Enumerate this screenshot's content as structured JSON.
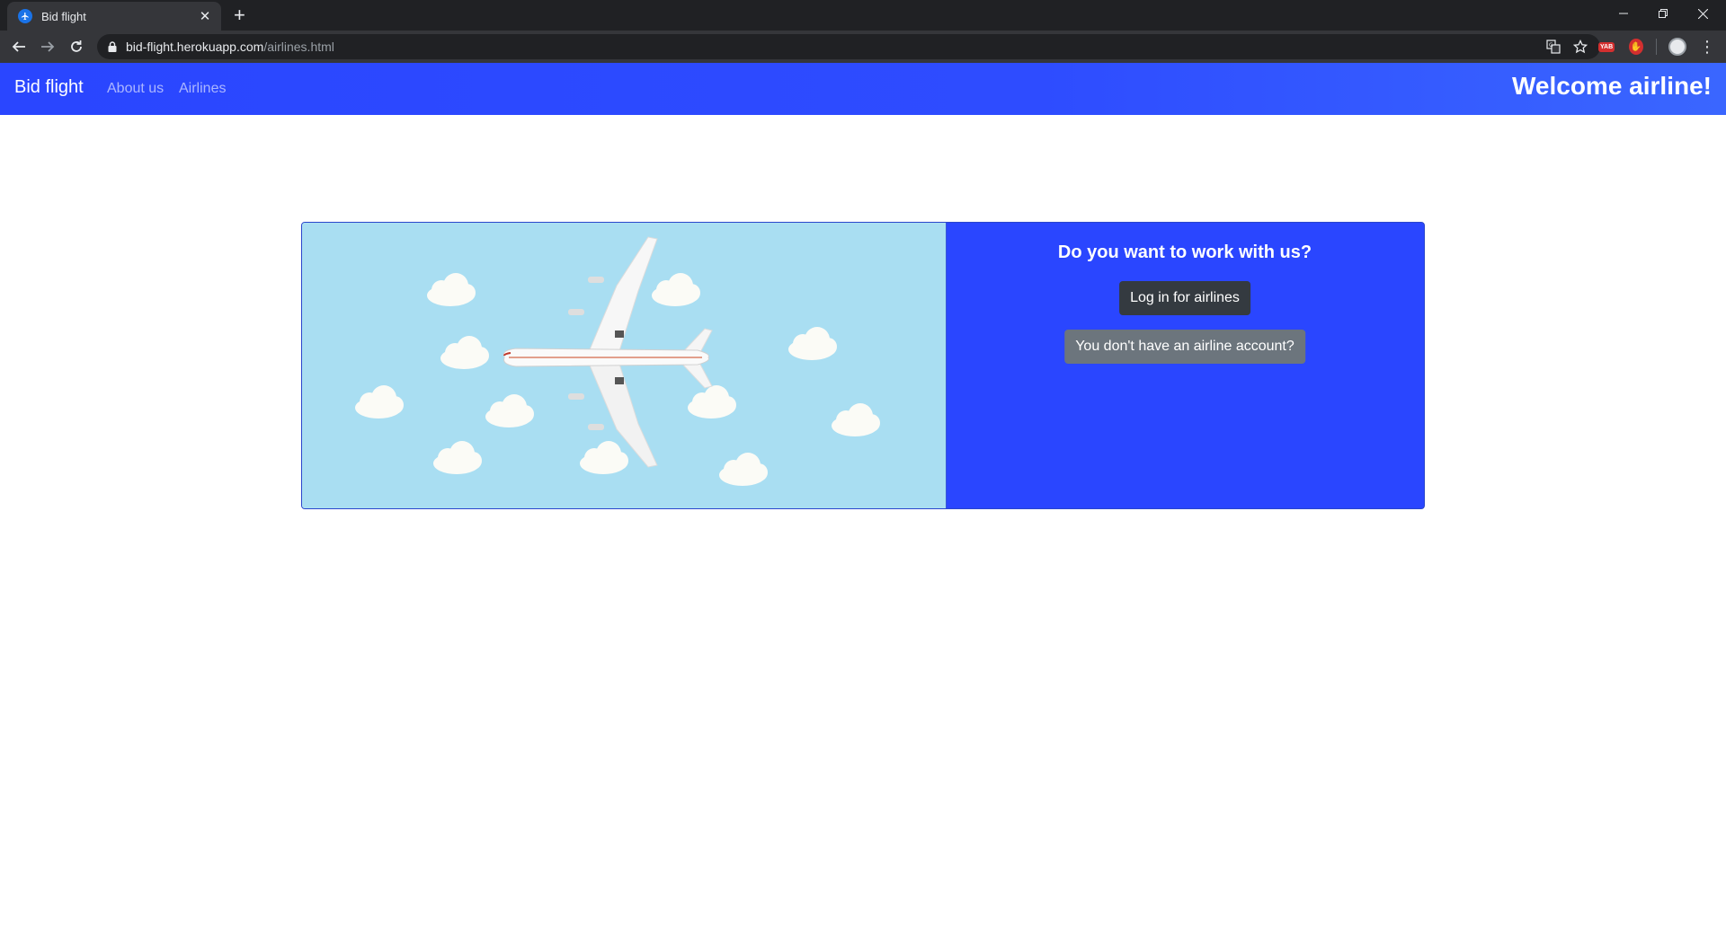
{
  "browser": {
    "tab_title": "Bid flight",
    "new_tab_label": "+",
    "url_host": "bid-flight.herokuapp.com",
    "url_path": "/airlines.html",
    "extension_badge": "YAB"
  },
  "navbar": {
    "brand": "Bid flight",
    "links": [
      "About us",
      "Airlines"
    ],
    "welcome": "Welcome airline!"
  },
  "card": {
    "title": "Do you want to work with us?",
    "login_button": "Log in for airlines",
    "register_button": "You don't have an airline account?"
  },
  "colors": {
    "navbar": "#2a46ff",
    "panel": "#2a46ff",
    "hero_sky": "#a9def2",
    "login_button": "#343a40",
    "register_button": "#6c757d"
  },
  "icons": {
    "favicon": "airplane-icon",
    "back": "arrow-left-icon",
    "forward": "arrow-right-icon",
    "reload": "reload-icon",
    "lock": "lock-icon",
    "translate": "translate-icon",
    "bookmark": "star-icon"
  }
}
